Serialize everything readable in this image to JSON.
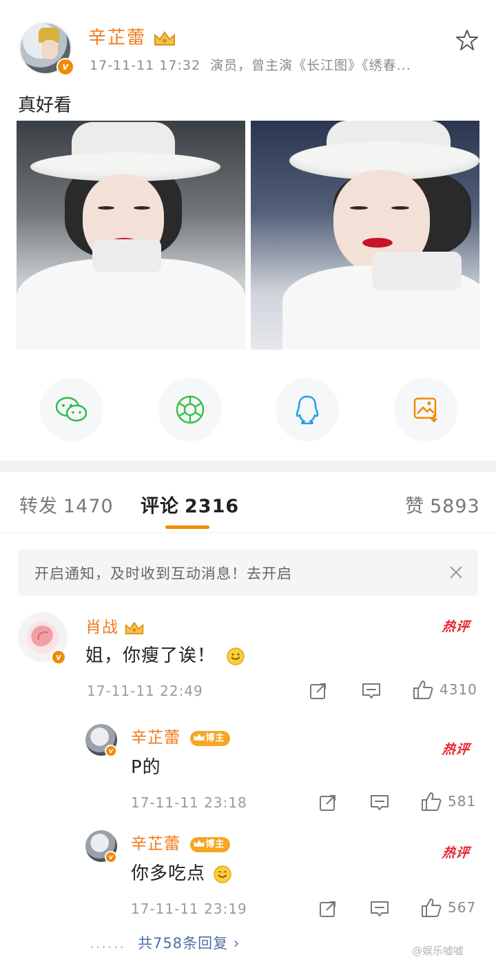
{
  "post": {
    "author": "辛芷蕾",
    "timestamp": "17-11-11 17:32",
    "description": "演员，曾主演《长江图》《绣春...",
    "text": "真好看",
    "images": [
      "photo-1",
      "photo-2"
    ]
  },
  "share_buttons": [
    "wechat-icon",
    "moments-icon",
    "qq-icon",
    "save-image-icon"
  ],
  "tabs": [
    {
      "label": "转发",
      "count": "1470"
    },
    {
      "label": "评论",
      "count": "2316"
    },
    {
      "label": "赞",
      "count": "5893"
    }
  ],
  "notice": {
    "text": "开启通知，及时收到互动消息！去开启"
  },
  "comments": [
    {
      "author": "肖战",
      "text": "姐，你瘦了诶！",
      "time": "17-11-11 22:49",
      "hot_tag": "热评",
      "likes": "4310"
    }
  ],
  "replies": [
    {
      "author": "辛芷蕾",
      "badge": "博主",
      "text": "P的",
      "time": "17-11-11 23:18",
      "hot_tag": "热评",
      "likes": "581"
    },
    {
      "author": "辛芷蕾",
      "badge": "博主",
      "text": "你多吃点",
      "time": "17-11-11 23:19",
      "hot_tag": "热评",
      "likes": "567"
    }
  ],
  "more_replies": "共758条回复 ›",
  "more_dots": "......",
  "watermark": "@娱乐嘘嘘",
  "colors": {
    "accent": "#f08a00",
    "name": "#f07a19",
    "hot": "#e8242c",
    "link": "#4a6fa5"
  }
}
